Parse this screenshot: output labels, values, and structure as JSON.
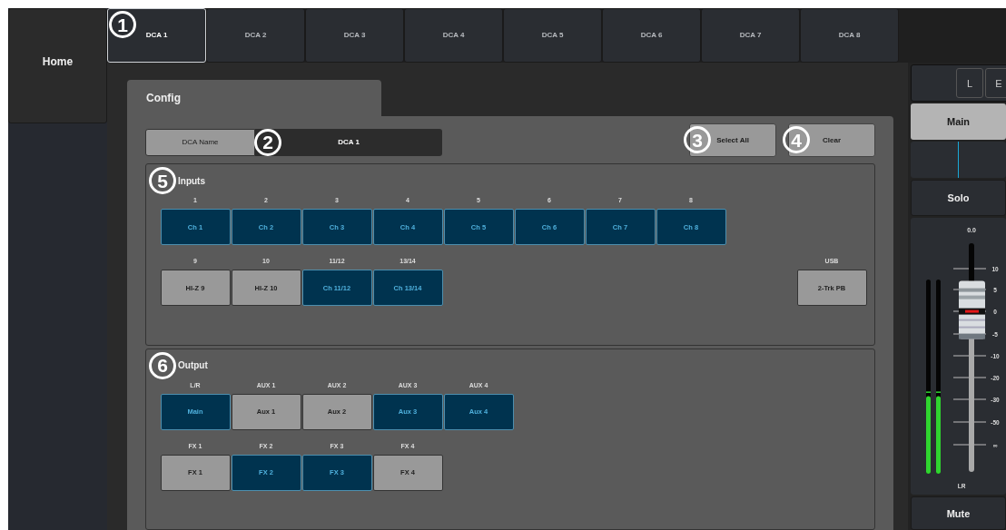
{
  "sidebar": {
    "home": "Home"
  },
  "tabs": [
    {
      "label": "DCA 1",
      "selected": true,
      "callout": "1"
    },
    {
      "label": "DCA 2",
      "selected": false
    },
    {
      "label": "DCA 3",
      "selected": false
    },
    {
      "label": "DCA 4",
      "selected": false
    },
    {
      "label": "DCA 5",
      "selected": false
    },
    {
      "label": "DCA 6",
      "selected": false
    },
    {
      "label": "DCA 7",
      "selected": false
    },
    {
      "label": "DCA 8",
      "selected": false
    }
  ],
  "config": {
    "tab": "Config",
    "name_label": "DCA Name",
    "name_value": "DCA 1",
    "name_callout": "2",
    "actions": [
      {
        "label": "Select All",
        "callout": "3"
      },
      {
        "label": "Clear",
        "callout": "4"
      }
    ]
  },
  "sections": [
    {
      "title": "Inputs",
      "callout": "5",
      "rows": [
        [
          [
            {
              "header": "1",
              "label": "Ch 1",
              "selected": true
            },
            {
              "header": "2",
              "label": "Ch 2",
              "selected": true
            },
            {
              "header": "3",
              "label": "Ch 3",
              "selected": true
            },
            {
              "header": "4",
              "label": "Ch 4",
              "selected": true
            },
            {
              "header": "5",
              "label": "Ch 5",
              "selected": true
            },
            {
              "header": "6",
              "label": "Ch 6",
              "selected": true
            },
            {
              "header": "7",
              "label": "Ch 7",
              "selected": true
            },
            {
              "header": "8",
              "label": "Ch 8",
              "selected": true
            }
          ]
        ],
        [
          [
            {
              "header": "9",
              "label": "HI-Z 9",
              "selected": false
            },
            {
              "header": "10",
              "label": "HI-Z 10",
              "selected": false
            },
            {
              "header": "11/12",
              "label": "Ch 11/12",
              "selected": true
            },
            {
              "header": "13/14",
              "label": "Ch 13/14",
              "selected": true
            }
          ],
          [
            {
              "header": "USB",
              "label": "2-Trk PB",
              "selected": false
            }
          ]
        ]
      ]
    },
    {
      "title": "Output",
      "callout": "6",
      "rows": [
        [
          [
            {
              "header": "L/R",
              "label": "Main",
              "selected": true
            },
            {
              "header": "AUX 1",
              "label": "Aux 1",
              "selected": false
            },
            {
              "header": "AUX 2",
              "label": "Aux 2",
              "selected": false
            },
            {
              "header": "AUX 3",
              "label": "Aux 3",
              "selected": true
            },
            {
              "header": "AUX 4",
              "label": "Aux 4",
              "selected": true
            }
          ]
        ],
        [
          [
            {
              "header": "FX 1",
              "label": "FX 1",
              "selected": false
            },
            {
              "header": "FX 2",
              "label": "FX 2",
              "selected": true
            },
            {
              "header": "FX 3",
              "label": "FX 3",
              "selected": true
            },
            {
              "header": "FX 4",
              "label": "FX 4",
              "selected": false
            }
          ]
        ]
      ]
    }
  ],
  "strip": {
    "buttons": [
      "L",
      "E"
    ],
    "bus": {
      "label": "Main",
      "selected": true
    },
    "solo": "Solo",
    "mute": "Mute",
    "fader": {
      "reading": "0.0",
      "level": 0.7,
      "scale": [
        "10",
        "5",
        "0",
        "-5",
        "-10",
        "-20",
        "-30",
        "-50",
        "∞"
      ],
      "channel": "LR"
    },
    "meters": [
      {
        "level": 0.4
      },
      {
        "level": 0.4
      }
    ]
  }
}
